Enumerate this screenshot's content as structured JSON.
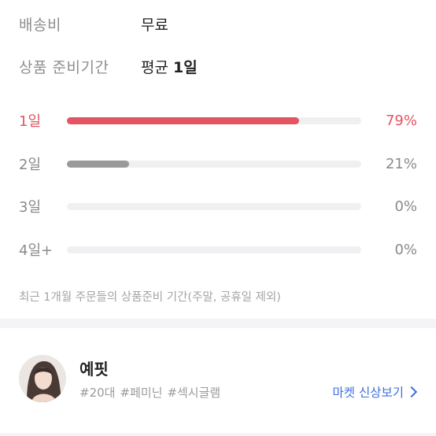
{
  "shipping": {
    "label": "배송비",
    "value": "무료"
  },
  "prep_time": {
    "label": "상품 준비기간",
    "value_prefix": "평균 ",
    "value_bold": "1일"
  },
  "distribution": [
    {
      "day": "1일",
      "percent_label": "79%",
      "fraction": 0.79,
      "color": "#e25562",
      "highlight": true
    },
    {
      "day": "2일",
      "percent_label": "21%",
      "fraction": 0.21,
      "color": "#9a9a9a",
      "highlight": false
    },
    {
      "day": "3일",
      "percent_label": "0%",
      "fraction": 0,
      "color": "#9a9a9a",
      "highlight": false
    },
    {
      "day": "4일+",
      "percent_label": "0%",
      "fraction": 0,
      "color": "#9a9a9a",
      "highlight": false
    }
  ],
  "note": "최근 1개월 주문들의 상품준비 기간(주말, 공휴일 제외)",
  "seller": {
    "name": "예핏",
    "tags": [
      "#20대",
      "#페미닌",
      "#섹시글램"
    ],
    "link_label": "마켓 신상보기"
  },
  "colors": {
    "accent": "#e25562",
    "link": "#3d6fe0"
  }
}
